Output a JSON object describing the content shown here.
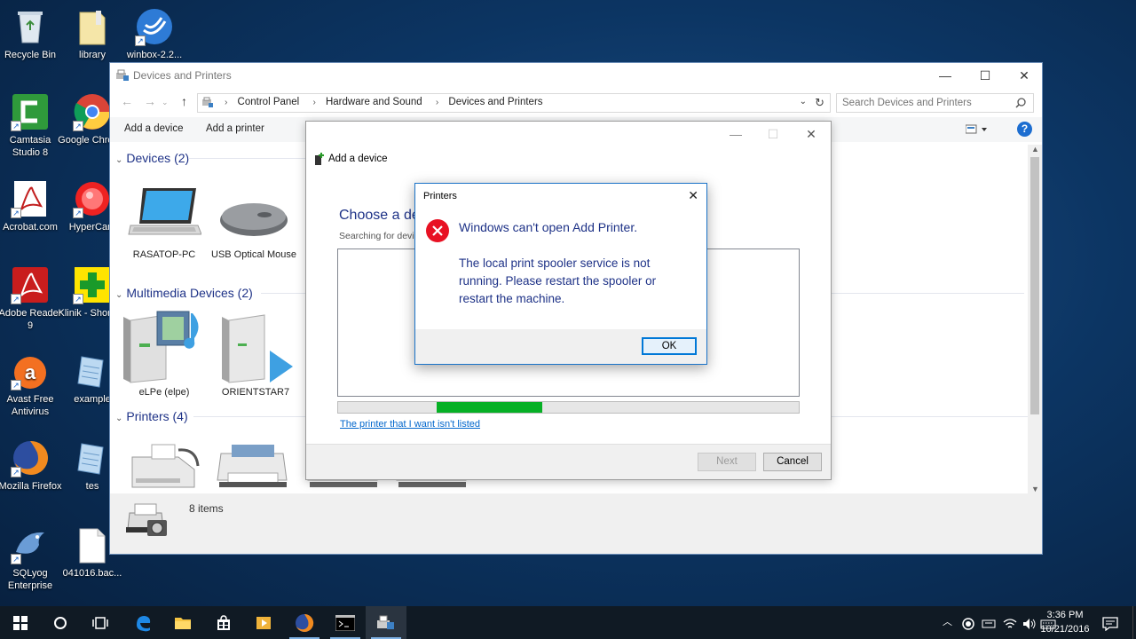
{
  "desktop": {
    "icons": [
      {
        "label": "Recycle Bin",
        "icon": "recycle-bin-icon"
      },
      {
        "label": "library",
        "icon": "folder-icon"
      },
      {
        "label": "winbox-2.2...",
        "icon": "winbox-icon"
      },
      {
        "label": "Camtasia Studio 8",
        "icon": "camtasia-icon"
      },
      {
        "label": "Google Chrome",
        "icon": "chrome-icon"
      },
      {
        "label": "Acrobat.com",
        "icon": "acrobat-icon"
      },
      {
        "label": "HyperCam",
        "icon": "hypercam-icon"
      },
      {
        "label": "Adobe Reader 9",
        "icon": "adobe-reader-icon"
      },
      {
        "label": "Klinik - Shortcut",
        "icon": "klinik-icon"
      },
      {
        "label": "Avast Free Antivirus",
        "icon": "avast-icon"
      },
      {
        "label": "example",
        "icon": "document-icon"
      },
      {
        "label": "Mozilla Firefox",
        "icon": "firefox-icon"
      },
      {
        "label": "tes",
        "icon": "document-icon"
      },
      {
        "label": "SQLyog Enterprise",
        "icon": "sqlyog-icon"
      },
      {
        "label": "041016.bac...",
        "icon": "file-icon"
      }
    ]
  },
  "explorer": {
    "title": "Devices and Printers",
    "breadcrumb": [
      "Control Panel",
      "Hardware and Sound",
      "Devices and Printers"
    ],
    "search_placeholder": "Search Devices and Printers",
    "commands": {
      "add_device": "Add a device",
      "add_printer": "Add a printer"
    },
    "groups": [
      {
        "label": "Devices (2)",
        "items": [
          "RASATOP-PC",
          "USB Optical Mouse"
        ]
      },
      {
        "label": "Multimedia Devices (2)",
        "items": [
          "eLPe (elpe)",
          "ORIENTSTAR7"
        ]
      },
      {
        "label": "Printers (4)",
        "items": []
      }
    ],
    "status": "8 items"
  },
  "wizard": {
    "title": "Add a device",
    "heading": "Choose a de",
    "subheading": "Searching for devi",
    "progress": 0.23,
    "link": "The printer that I want isn't listed",
    "next": "Next",
    "cancel": "Cancel"
  },
  "dialog": {
    "title": "Printers",
    "main": "Windows can't open Add Printer.",
    "detail": "The local print spooler service is not running. Please restart the spooler or restart the machine.",
    "ok": "OK"
  },
  "taskbar": {
    "time": "3:36 PM",
    "date": "10/21/2016"
  },
  "colors": {
    "accent": "#0078d7",
    "error": "#e81123",
    "progress": "#06b025",
    "group_header": "#1e3287",
    "link": "#0066cc"
  }
}
